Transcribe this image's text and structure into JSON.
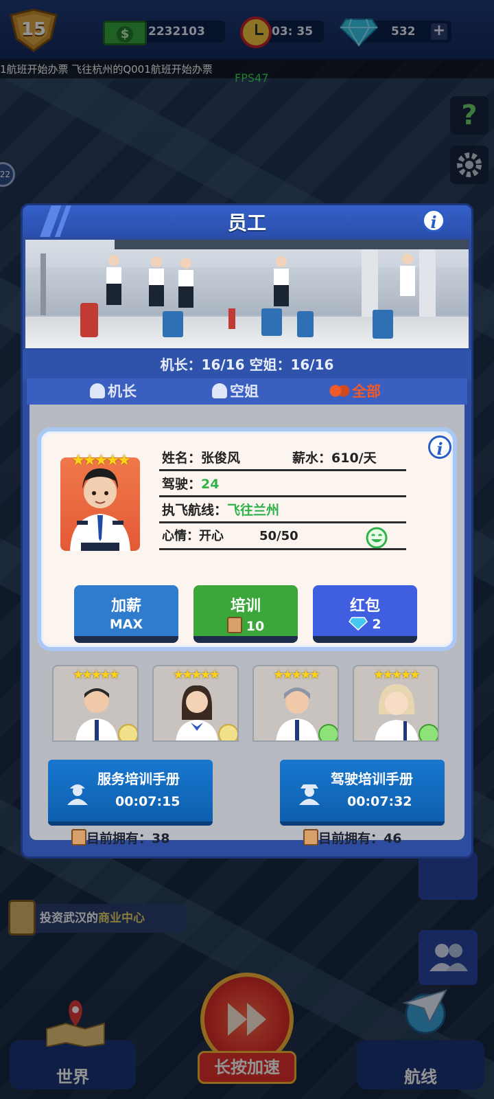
{
  "hud": {
    "level": "15",
    "money": "2232103",
    "money_icon": "dollar-bill-icon",
    "timer": "03: 35",
    "gems": "532",
    "add_label": "+"
  },
  "marquee": "1航班开始办票    飞往杭州的Q001航班开始办票",
  "fps": "FPS47",
  "side": {
    "help": "?",
    "badge": "22"
  },
  "panel": {
    "title": "员工",
    "info": "i",
    "counts": "机长：16/16    空姐：16/16",
    "tabs": [
      {
        "label": "机长",
        "active": false
      },
      {
        "label": "空姐",
        "active": false
      },
      {
        "label": "全部",
        "active": true
      }
    ]
  },
  "card": {
    "info": "i",
    "stars": "★★★★★",
    "name_label": "姓名：",
    "name": "张俊风",
    "salary_label": "薪水：",
    "salary": "610/天",
    "drive_label": "驾驶：",
    "drive": "24",
    "route_label": "执飞航线：",
    "route": "飞往兰州",
    "mood_label": "心情：",
    "mood": "开心",
    "mood_value": "50/50",
    "actions": [
      {
        "label": "加薪",
        "sub": "MAX",
        "color": "#2f7ccc"
      },
      {
        "label": "培训",
        "sub": "10",
        "color": "#3ba63a"
      },
      {
        "label": "红包",
        "sub": "2",
        "color": "#3f5ee0"
      }
    ]
  },
  "staff": [
    {
      "stars": "★★★★★",
      "mood": "neutral"
    },
    {
      "stars": "★★★★★",
      "mood": "neutral"
    },
    {
      "stars": "★★★★★",
      "mood": "happy"
    },
    {
      "stars": "★★★★★",
      "mood": "happy"
    }
  ],
  "manuals": [
    {
      "title": "服务培训手册",
      "timer": "00:07:15",
      "owned_label": "目前拥有：",
      "owned": "38"
    },
    {
      "title": "驾驶培训手册",
      "timer": "00:07:32",
      "owned_label": "目前拥有：",
      "owned": "46"
    }
  ],
  "notice": {
    "prefix": "投资武汉的",
    "highlight": "商业中心"
  },
  "bottom": {
    "world": "世界",
    "speed": "长按加速",
    "routes": "航线"
  }
}
